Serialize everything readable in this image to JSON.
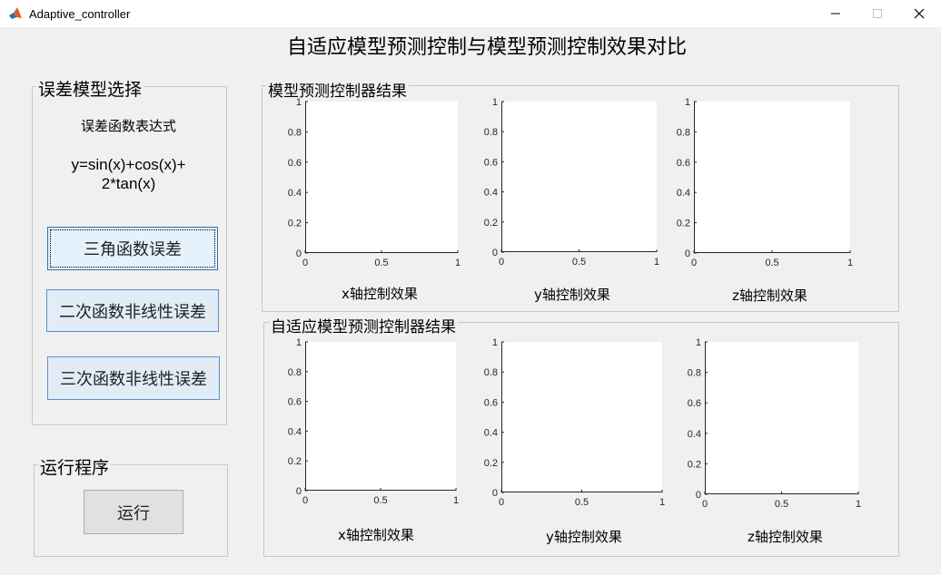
{
  "window": {
    "title": "Adaptive_controller",
    "minimize_label": "minimize",
    "maximize_label": "maximize",
    "close_label": "close"
  },
  "main_title": "自适应模型预测控制与模型预测控制效果对比",
  "error_panel": {
    "title": "误差模型选择",
    "expression_label": "误差函数表达式",
    "expression_line1": "y=sin(x)+cos(x)+",
    "expression_line2": "2*tan(x)",
    "buttons": [
      "三角函数误差",
      "二次函数非线性误差",
      "三次函数非线性误差"
    ]
  },
  "run_panel": {
    "title": "运行程序",
    "run_label": "运行"
  },
  "mpc_panel": {
    "title": "模型预测控制器结果",
    "axes_labels": [
      "x轴控制效果",
      "y轴控制效果",
      "z轴控制效果"
    ]
  },
  "ampc_panel": {
    "title": "自适应模型预测控制器结果",
    "axes_labels": [
      "x轴控制效果",
      "y轴控制效果",
      "z轴控制效果"
    ]
  },
  "chart_data": {
    "type": "line",
    "xlim": [
      0,
      1
    ],
    "ylim": [
      0,
      1
    ],
    "xticks": [
      "0",
      "0.5",
      "1"
    ],
    "yticks": [
      "0",
      "0.2",
      "0.4",
      "0.6",
      "0.8",
      "1"
    ],
    "series": []
  }
}
